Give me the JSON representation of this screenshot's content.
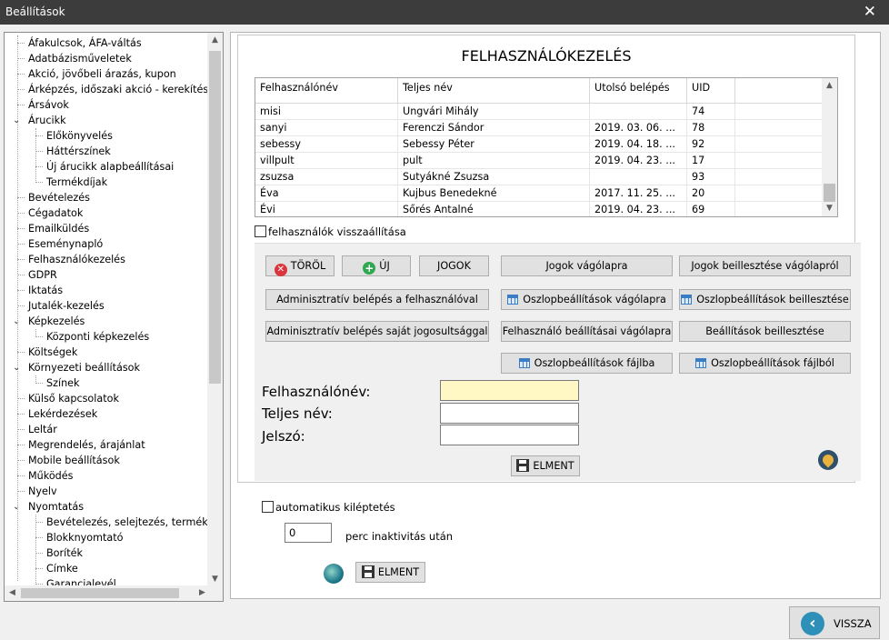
{
  "window": {
    "title": "Beállítások",
    "close_symbol": "✕"
  },
  "tree": {
    "items": [
      {
        "label": "Áfakulcsok, ÁFA-váltás",
        "level": 0
      },
      {
        "label": "Adatbázisműveletek",
        "level": 0
      },
      {
        "label": "Akció, jövőbeli árazás, kupon",
        "level": 0
      },
      {
        "label": "Árképzés, időszaki akció - kerekítés",
        "level": 0
      },
      {
        "label": "Ársávok",
        "level": 0
      },
      {
        "label": "Árucikk",
        "level": 0,
        "expanded": true
      },
      {
        "label": "Előkönyvelés",
        "level": 1
      },
      {
        "label": "Háttérszínek",
        "level": 1
      },
      {
        "label": "Új árucikk alapbeállításai",
        "level": 1
      },
      {
        "label": "Termékdíjak",
        "level": 1
      },
      {
        "label": "Bevételezés",
        "level": 0
      },
      {
        "label": "Cégadatok",
        "level": 0
      },
      {
        "label": "Emailküldés",
        "level": 0
      },
      {
        "label": "Eseménynapló",
        "level": 0
      },
      {
        "label": "Felhasználókezelés",
        "level": 0
      },
      {
        "label": "GDPR",
        "level": 0
      },
      {
        "label": "Iktatás",
        "level": 0
      },
      {
        "label": "Jutalék-kezelés",
        "level": 0
      },
      {
        "label": "Képkezelés",
        "level": 0,
        "expanded": true
      },
      {
        "label": "Központi képkezelés",
        "level": 1
      },
      {
        "label": "Költségek",
        "level": 0
      },
      {
        "label": "Környezeti beállítások",
        "level": 0,
        "expanded": true
      },
      {
        "label": "Színek",
        "level": 1
      },
      {
        "label": "Külső kapcsolatok",
        "level": 0
      },
      {
        "label": "Lekérdezések",
        "level": 0
      },
      {
        "label": "Leltár",
        "level": 0
      },
      {
        "label": "Megrendelés, árajánlat",
        "level": 0
      },
      {
        "label": "Mobile beállítások",
        "level": 0
      },
      {
        "label": "Működés",
        "level": 0
      },
      {
        "label": "Nyelv",
        "level": 0
      },
      {
        "label": "Nyomtatás",
        "level": 0,
        "expanded": true
      },
      {
        "label": "Bevételezés, selejtezés, termékkia",
        "level": 1
      },
      {
        "label": "Blokknyomtató",
        "level": 1
      },
      {
        "label": "Boríték",
        "level": 1
      },
      {
        "label": "Címke",
        "level": 1
      },
      {
        "label": "Garancialevél",
        "level": 1
      }
    ]
  },
  "main": {
    "heading": "FELHASZNÁLÓKEZELÉS",
    "grid": {
      "columns": [
        "Felhasználónév",
        "Teljes név",
        "Utolsó belépés",
        "UID"
      ],
      "rows": [
        [
          "misi",
          "Ungvári Mihály",
          "",
          "74"
        ],
        [
          "sanyi",
          "Ferenczi Sándor",
          "2019. 03. 06. ...",
          "78"
        ],
        [
          "sebessy",
          "Sebessy Péter",
          "2019. 04. 18. ...",
          "92"
        ],
        [
          "villpult",
          "pult",
          "2019. 04. 23. ...",
          "17"
        ],
        [
          "zsuzsa",
          "Sutyákné Zsuzsa",
          "",
          "93"
        ],
        [
          "Éva",
          "Kujbus Benedekné",
          "2017. 11. 25. ...",
          "20"
        ],
        [
          "Évi",
          "Sőrés Antalné",
          "2019. 04. 23. ...",
          "69"
        ]
      ]
    },
    "restore_label": "felhasználók visszaállítása",
    "buttons": {
      "delete": "TÖRÖL",
      "new": "ÚJ",
      "rights": "JOGOK",
      "admin_login_user": "Adminisztratív belépés a felhasználóval",
      "admin_login_own": "Adminisztratív belépés saját jogosultsággal",
      "rights_to_clipboard": "Jogok vágólapra",
      "rights_from_clipboard": "Jogok beillesztése vágólapról",
      "col_settings_to_clipboard": "Oszlopbeállítások vágólapra",
      "col_settings_paste": "Oszlopbeállítások beillesztése",
      "user_settings_to_clipboard": "Felhasználó beállításai vágólapra",
      "settings_paste": "Beállítások beillesztése",
      "col_settings_to_file": "Oszlopbeállítások fájlba",
      "col_settings_from_file": "Oszlopbeállítások fájlból",
      "save": "ELMENT"
    },
    "form": {
      "username_label": "Felhasználónév:",
      "username_value": "",
      "fullname_label": "Teljes név:",
      "fullname_value": "",
      "password_label": "Jelszó:",
      "password_value": ""
    },
    "auto_logout": {
      "label": "automatikus kiléptetés",
      "minutes_value": "0",
      "minutes_suffix": "perc inaktivitás után",
      "save": "ELMENT"
    }
  },
  "footer": {
    "back": "VISSZA"
  }
}
